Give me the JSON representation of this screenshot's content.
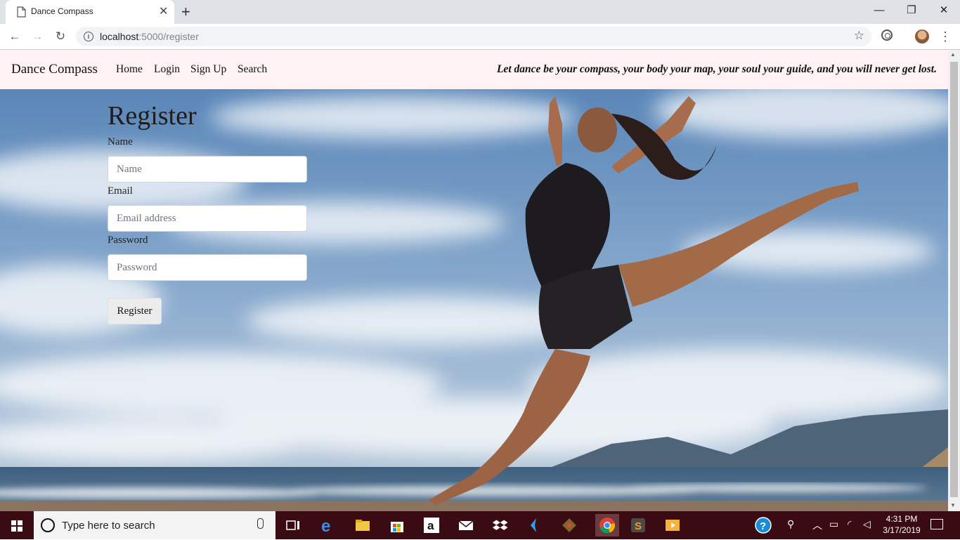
{
  "browser": {
    "tab_title": "Dance Compass",
    "url_host": "localhost",
    "url_rest": ":5000/register"
  },
  "navbar": {
    "brand": "Dance Compass",
    "links": [
      "Home",
      "Login",
      "Sign Up",
      "Search"
    ],
    "tagline": "Let dance be your compass, your body your map, your soul your guide, and you will never get lost."
  },
  "form": {
    "title": "Register",
    "name_label": "Name",
    "name_placeholder": "Name",
    "email_label": "Email",
    "email_placeholder": "Email address",
    "password_label": "Password",
    "password_placeholder": "Password",
    "submit_label": "Register"
  },
  "taskbar": {
    "search_placeholder": "Type here to search",
    "time": "4:31 PM",
    "date": "3/17/2019",
    "apps": [
      "task-view-icon",
      "edge-icon",
      "file-explorer-icon",
      "store-icon",
      "amazon-icon",
      "mail-icon",
      "dropbox-icon",
      "visual-studio-icon",
      "git-icon",
      "chrome-icon",
      "sublime-text-icon",
      "media-player-icon"
    ]
  },
  "colors": {
    "navbar_bg": "#fff2f4",
    "taskbar_bg": "#3a0b12",
    "button_bg": "#ececec"
  }
}
